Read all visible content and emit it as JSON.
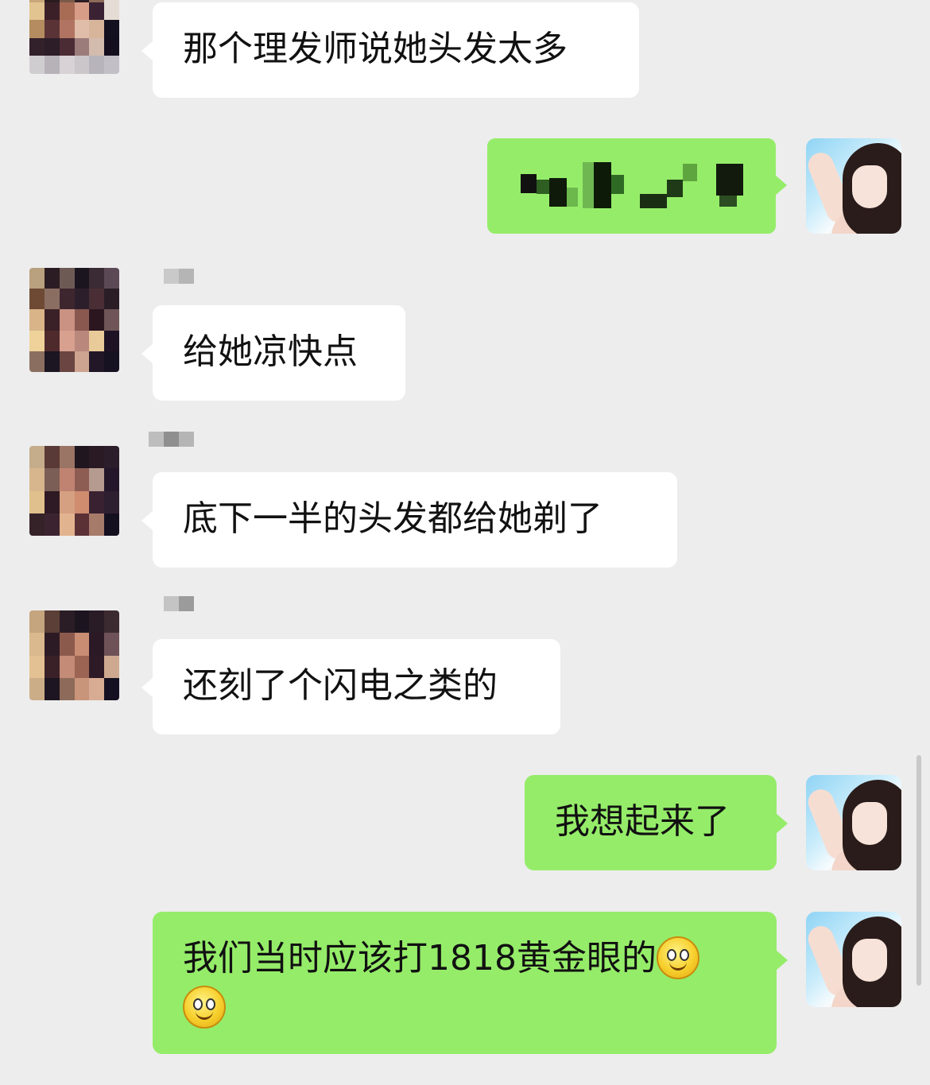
{
  "colors": {
    "background": "#ededed",
    "incoming_bubble": "#ffffff",
    "outgoing_bubble": "#95ec69"
  },
  "messages": [
    {
      "side": "in",
      "text": "那个理发师说她头发太多"
    },
    {
      "side": "out",
      "text": ""
    },
    {
      "side": "in",
      "text": "给她凉快点"
    },
    {
      "side": "in",
      "text": "底下一半的头发都给她剃了"
    },
    {
      "side": "in",
      "text": "还刻了个闪电之类的"
    },
    {
      "side": "out",
      "text": "我想起来了"
    },
    {
      "side": "out",
      "text": "我们当时应该打1818黄金眼的"
    }
  ],
  "icons": {
    "emoji": "smiley-emoji-icon",
    "contact_avatar": "pixelated-avatar-icon",
    "self_avatar": "user-avatar-icon"
  }
}
